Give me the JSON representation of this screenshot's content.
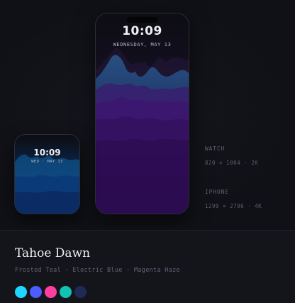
{
  "phone": {
    "time": "10:09",
    "date": "WEDNESDAY, MAY 13"
  },
  "watch": {
    "time": "10:09",
    "date": "WED · MAY 13"
  },
  "specs": [
    {
      "label": "WATCH",
      "value": "820 × 1004 · 2K"
    },
    {
      "label": "IPHONE",
      "value": "1290 × 2796 · 4K"
    }
  ],
  "theme": {
    "name": "Tahoe Dawn",
    "colors_line": "Frosted Teal · Electric Blue · Magenta Haze",
    "swatches": [
      {
        "name": "cyan-swatch",
        "color": "#1fd6ff"
      },
      {
        "name": "blue-swatch",
        "color": "#4d5cff"
      },
      {
        "name": "magenta-swatch",
        "color": "#ff3fa0"
      },
      {
        "name": "teal-swatch",
        "color": "#12c2b2"
      },
      {
        "name": "navy-swatch",
        "color": "#1d2b55"
      }
    ]
  }
}
